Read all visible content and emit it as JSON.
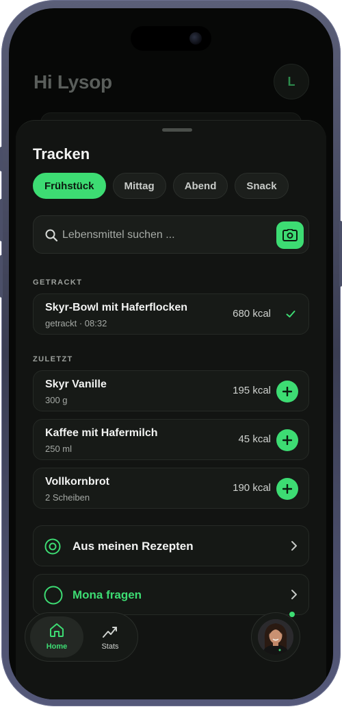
{
  "header": {
    "greeting": "Hi Lysop",
    "avatar_initial": "L"
  },
  "sheet": {
    "title": "Tracken",
    "meal_tabs": [
      {
        "label": "Frühstück",
        "active": true
      },
      {
        "label": "Mittag",
        "active": false
      },
      {
        "label": "Abend",
        "active": false
      },
      {
        "label": "Snack",
        "active": false
      }
    ],
    "search": {
      "placeholder": "Lebensmittel suchen ..."
    },
    "tracked_label": "GETRACKT",
    "tracked": [
      {
        "name": "Skyr-Bowl mit Haferflocken",
        "sub": "getrackt · 08:32",
        "kcal": "680 kcal"
      }
    ],
    "recent_label": "ZULETZT",
    "recent": [
      {
        "name": "Skyr Vanille",
        "sub": "300 g",
        "kcal": "195 kcal"
      },
      {
        "name": "Kaffee mit Hafermilch",
        "sub": "250 ml",
        "kcal": "45 kcal"
      },
      {
        "name": "Vollkornbrot",
        "sub": "2 Scheiben",
        "kcal": "190 kcal"
      }
    ],
    "actions": [
      {
        "label": "Aus meinen Rezepten",
        "icon": "target-icon"
      },
      {
        "label": "Mona fragen",
        "icon": "ring-icon"
      }
    ]
  },
  "nav": {
    "home_label": "Home",
    "stats_label": "Stats"
  },
  "colors": {
    "accent": "#3ddc73",
    "background": "#070807",
    "sheet": "#121412"
  }
}
